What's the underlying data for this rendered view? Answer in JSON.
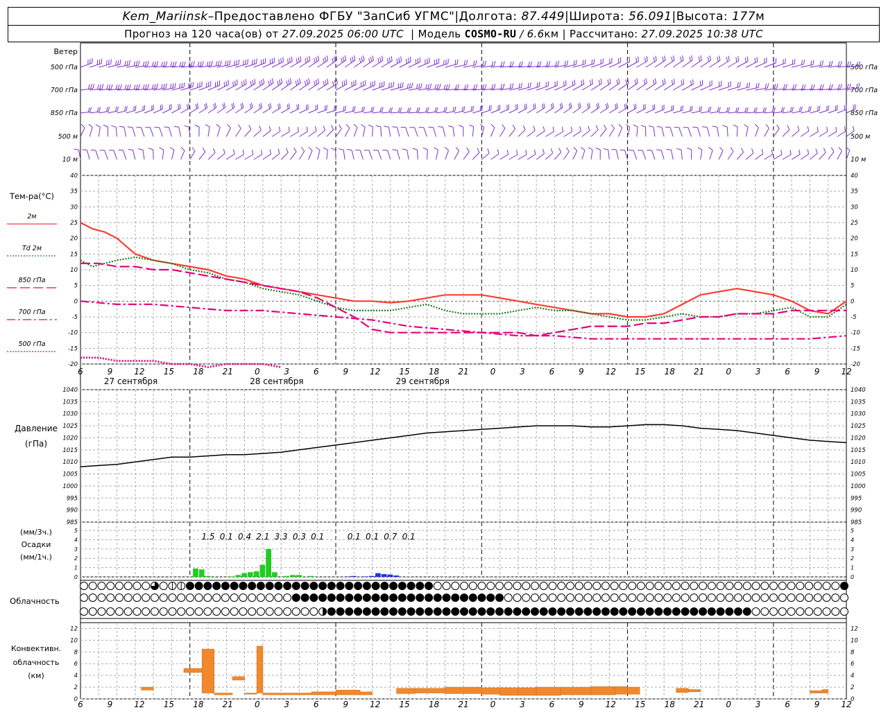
{
  "header": {
    "station": "Kem_Mariinsk",
    "dash": " – ",
    "provider": "Предоставлено ФГБУ \"ЗапСиб УГМС\"",
    "sep": " | ",
    "lon_label": "Долгота:",
    "lon_value": "87.449",
    "lat_label": "Широта:",
    "lat_value": "56.091",
    "alt_label": "Высота:",
    "alt_value": "177",
    "alt_unit": "м",
    "forecast_text": "Прогноз на 120 часа(ов) от",
    "issue_time": "27.09.2025 06:00 UTC",
    "model_label": "| Модель",
    "model_name": "COSMO-RU",
    "model_res": "/ 6.6",
    "model_res_unit": "км",
    "calc_label": "| Рассчитано:",
    "calc_time": "27.09.2025 10:38 UTC"
  },
  "time_axis": {
    "start_hour_utc": 6,
    "hours": 126,
    "hour_labels": [
      "6",
      "9",
      "12",
      "15",
      "18",
      "21",
      "0",
      "3",
      "6",
      "9",
      "12",
      "15",
      "18",
      "21",
      "0",
      "3",
      "6",
      "9",
      "12",
      "15",
      "18",
      "21",
      "0",
      "3",
      "6",
      "9",
      "12"
    ],
    "midnight_hours": [
      18,
      42,
      66,
      90,
      114
    ],
    "day_labels": [
      {
        "text": "27 сентября",
        "hour": 6
      },
      {
        "text": "28 сентября",
        "hour": 30
      },
      {
        "text": "29 сентября",
        "hour": 54
      }
    ]
  },
  "wind_panel": {
    "title": "Ветер",
    "levels": [
      "500 гПа",
      "700 гПа",
      "850 гПа",
      "500 м",
      "10 м"
    ],
    "color": "#7b2fc9"
  },
  "temp_panel": {
    "title": "Тем-ра(°С)",
    "ticks": [
      "40",
      "35",
      "30",
      "25",
      "20",
      "15",
      "10",
      "5",
      "0",
      "-5",
      "-10",
      "-15",
      "-20"
    ],
    "legend": [
      {
        "label": "2м",
        "color": "#ff3b30",
        "style": "solid"
      },
      {
        "label": "Td 2м",
        "color": "#1a7a1a",
        "style": "dotted"
      },
      {
        "label": "850 гПа",
        "color": "#e6007e",
        "style": "dashed"
      },
      {
        "label": "700 гПа",
        "color": "#e6007e",
        "style": "dashdot"
      },
      {
        "label": "500 гПа",
        "color": "#e6007e",
        "style": "dotted"
      }
    ]
  },
  "pressure_panel": {
    "title": "Давление",
    "unit": "(гПа)",
    "ticks": [
      "1040",
      "1035",
      "1030",
      "1025",
      "1020",
      "1015",
      "1010",
      "1005",
      "1000",
      "995",
      "990",
      "985"
    ]
  },
  "precip_panel": {
    "unit_top": "(мм/3ч.)",
    "title": "Осадки",
    "unit_bottom": "(мм/1ч.)",
    "ticks": [
      "5",
      "4",
      "3",
      "2",
      "1",
      "0"
    ],
    "totals": [
      {
        "text": "1.5",
        "hour": 21
      },
      {
        "text": "0.1",
        "hour": 24
      },
      {
        "text": "0.4",
        "hour": 27
      },
      {
        "text": "2.1",
        "hour": 30
      },
      {
        "text": "3.3",
        "hour": 33
      },
      {
        "text": "0.3",
        "hour": 36
      },
      {
        "text": "0.1",
        "hour": 39
      },
      {
        "text": "0.1",
        "hour": 45
      },
      {
        "text": "0.1",
        "hour": 48
      },
      {
        "text": "0.7",
        "hour": 51
      },
      {
        "text": "0.1",
        "hour": 54
      }
    ]
  },
  "cloud_panel": {
    "title": "Облачность"
  },
  "conv_panel": {
    "title_line1": "Конвективн.",
    "title_line2": "облачность",
    "unit": "(км)",
    "ticks": [
      "12",
      "10",
      "8",
      "6",
      "4",
      "2",
      "0"
    ]
  },
  "chart_data": {
    "type": "line",
    "x_unit": "hours from 27.09.2025 06:00 UTC",
    "temperature": {
      "ylim": [
        -20,
        40
      ],
      "series": [
        {
          "name": "2м",
          "x": [
            0,
            2,
            4,
            6,
            9,
            12,
            15,
            18,
            21,
            24,
            27,
            30,
            33,
            36,
            39,
            42,
            45,
            48,
            51,
            54,
            57,
            60,
            63,
            66,
            69,
            72,
            75,
            78,
            81,
            84,
            87,
            90,
            93,
            96,
            99,
            102,
            105,
            108,
            111,
            114,
            117,
            120,
            123,
            126
          ],
          "values": [
            25,
            23,
            22,
            20,
            15,
            13,
            12,
            11,
            10,
            8,
            7,
            5,
            4,
            3,
            2,
            1,
            0,
            0,
            -0.5,
            0,
            1,
            2,
            2,
            2,
            1,
            0,
            -1,
            -2,
            -3,
            -4,
            -4,
            -5,
            -5,
            -4,
            -1,
            2,
            3,
            4,
            3,
            2,
            0,
            -3,
            -4,
            0
          ]
        },
        {
          "name": "Td 2м",
          "x": [
            0,
            2,
            4,
            6,
            9,
            12,
            15,
            18,
            21,
            24,
            27,
            30,
            33,
            36,
            39,
            42,
            45,
            48,
            51,
            54,
            57,
            60,
            63,
            66,
            69,
            72,
            75,
            78,
            81,
            84,
            87,
            90,
            93,
            96,
            99,
            102,
            105,
            108,
            111,
            114,
            117,
            120,
            123,
            126
          ],
          "values": [
            13,
            11,
            12,
            13,
            14,
            13,
            12,
            10,
            9,
            7,
            6,
            4,
            3,
            2,
            0,
            -2,
            -3,
            -3,
            -3,
            -2,
            -1,
            -3,
            -4,
            -4,
            -4,
            -3,
            -2,
            -3,
            -3,
            -4,
            -5,
            -6,
            -6,
            -5,
            -4,
            -5,
            -5,
            -4,
            -4,
            -3,
            -2,
            -5,
            -5,
            -1
          ]
        },
        {
          "name": "850 гПа",
          "x": [
            0,
            3,
            6,
            9,
            12,
            15,
            18,
            21,
            24,
            27,
            30,
            33,
            36,
            39,
            42,
            45,
            48,
            51,
            54,
            57,
            60,
            63,
            66,
            69,
            72,
            75,
            78,
            81,
            84,
            87,
            90,
            93,
            96,
            99,
            102,
            105,
            108,
            111,
            114,
            117,
            120,
            123,
            126
          ],
          "values": [
            12,
            12,
            11,
            11,
            10,
            10,
            9,
            8,
            7,
            6,
            5,
            4,
            3,
            1,
            -2,
            -5,
            -9,
            -10,
            -10,
            -10,
            -10,
            -10,
            -10,
            -10,
            -10,
            -11,
            -10,
            -9,
            -8,
            -8,
            -8,
            -7,
            -7,
            -6,
            -5,
            -5,
            -4,
            -4,
            -4,
            -3,
            -3,
            -3,
            -3
          ]
        },
        {
          "name": "700 гПа",
          "x": [
            0,
            6,
            12,
            18,
            24,
            30,
            36,
            42,
            48,
            54,
            60,
            66,
            72,
            78,
            84,
            90,
            96,
            102,
            108,
            114,
            120,
            126
          ],
          "values": [
            0,
            -1,
            -1,
            -2,
            -3,
            -3,
            -4,
            -5,
            -6,
            -8,
            -9,
            -10,
            -11,
            -11,
            -12,
            -12,
            -12,
            -12,
            -12,
            -12,
            -12,
            -11
          ]
        },
        {
          "name": "500 гПа",
          "x": [
            0,
            3,
            6,
            9,
            12,
            15,
            18,
            21,
            24,
            27,
            30,
            33
          ],
          "values": [
            -18,
            -18,
            -19,
            -19,
            -19,
            -20,
            -20,
            -21,
            -20,
            -20,
            -20,
            -21
          ]
        }
      ]
    },
    "pressure": {
      "ylim": [
        985,
        1040
      ],
      "x": [
        0,
        3,
        6,
        9,
        12,
        15,
        18,
        21,
        24,
        27,
        30,
        33,
        36,
        39,
        42,
        45,
        48,
        51,
        54,
        57,
        60,
        63,
        66,
        69,
        72,
        75,
        78,
        81,
        84,
        87,
        90,
        93,
        96,
        99,
        102,
        105,
        108,
        111,
        114,
        117,
        120,
        123,
        126
      ],
      "values": [
        1008,
        1008.5,
        1009,
        1010,
        1011,
        1012,
        1012,
        1012.5,
        1013,
        1013,
        1013.5,
        1014,
        1015,
        1016,
        1017,
        1018,
        1019,
        1020,
        1021,
        1022,
        1022.5,
        1023,
        1023.5,
        1024,
        1024.5,
        1025,
        1025,
        1025,
        1024.5,
        1024.5,
        1025,
        1025.5,
        1025.5,
        1025,
        1024,
        1023.5,
        1023,
        1022,
        1021,
        1020,
        1019,
        1018.5,
        1018
      ]
    },
    "precipitation_mm_per_hour": {
      "ylim": [
        0,
        5
      ],
      "rain": [
        {
          "hour": 19,
          "value": 0.9
        },
        {
          "hour": 20,
          "value": 0.8
        },
        {
          "hour": 21,
          "value": 0.1
        },
        {
          "hour": 25,
          "value": 0.05
        },
        {
          "hour": 26,
          "value": 0.2
        },
        {
          "hour": 27,
          "value": 0.4
        },
        {
          "hour": 28,
          "value": 0.5
        },
        {
          "hour": 29,
          "value": 0.6
        },
        {
          "hour": 30,
          "value": 1.3
        },
        {
          "hour": 31,
          "value": 3.0
        },
        {
          "hour": 32,
          "value": 0.5
        },
        {
          "hour": 34,
          "value": 0.1
        },
        {
          "hour": 35,
          "value": 0.2
        },
        {
          "hour": 36,
          "value": 0.2
        },
        {
          "hour": 38,
          "value": 0.1
        }
      ],
      "snow": [
        {
          "hour": 44,
          "value": 0.05
        },
        {
          "hour": 45,
          "value": 0.1
        },
        {
          "hour": 47,
          "value": 0.05
        },
        {
          "hour": 48,
          "value": 0.1
        },
        {
          "hour": 49,
          "value": 0.4
        },
        {
          "hour": 50,
          "value": 0.3
        },
        {
          "hour": 51,
          "value": 0.25
        },
        {
          "hour": 52,
          "value": 0.15
        }
      ]
    },
    "cloud_rows": [
      "0000000000002300111244444444444444444444444444444444444444444444440000000000000000000000000000000000000000000000000000000000000000000000000004",
      "000000000000000000000000000000000000000344444444444444444444444444444444444444440000000000000000000000000000000000000000000000000000000000000000",
      "0000000000000000000000000000000000000000000024444444444444444444444444444444444444444444444444444444444444444444444444444444000000000000000000"
    ],
    "convective_cloud_km": [
      {
        "from": 10,
        "to": 12,
        "base": 1.5,
        "top": 2.0
      },
      {
        "from": 17,
        "to": 20,
        "base": 4.5,
        "top": 5.2
      },
      {
        "from": 20,
        "to": 22,
        "base": 1.0,
        "top": 8.5
      },
      {
        "from": 22,
        "to": 25,
        "base": 0.7,
        "top": 1.0
      },
      {
        "from": 25,
        "to": 27,
        "base": 3.2,
        "top": 3.8
      },
      {
        "from": 27,
        "to": 29,
        "base": 0.8,
        "top": 1.0
      },
      {
        "from": 29,
        "to": 30,
        "base": 1.0,
        "top": 9.0
      },
      {
        "from": 30,
        "to": 38,
        "base": 0.7,
        "top": 1.0
      },
      {
        "from": 38,
        "to": 42,
        "base": 0.7,
        "top": 1.2
      },
      {
        "from": 42,
        "to": 46,
        "base": 0.7,
        "top": 1.5
      },
      {
        "from": 46,
        "to": 48,
        "base": 0.7,
        "top": 1.2
      },
      {
        "from": 52,
        "to": 55,
        "base": 0.9,
        "top": 1.8
      },
      {
        "from": 55,
        "to": 60,
        "base": 1.0,
        "top": 1.8
      },
      {
        "from": 60,
        "to": 66,
        "base": 0.9,
        "top": 2.0
      },
      {
        "from": 66,
        "to": 69,
        "base": 0.8,
        "top": 1.9
      },
      {
        "from": 69,
        "to": 72,
        "base": 0.6,
        "top": 1.9
      },
      {
        "from": 72,
        "to": 75,
        "base": 0.6,
        "top": 1.9
      },
      {
        "from": 75,
        "to": 79,
        "base": 0.6,
        "top": 2.0
      },
      {
        "from": 79,
        "to": 84,
        "base": 0.7,
        "top": 2.0
      },
      {
        "from": 84,
        "to": 88,
        "base": 0.7,
        "top": 2.1
      },
      {
        "from": 88,
        "to": 90,
        "base": 0.8,
        "top": 2.1
      },
      {
        "from": 90,
        "to": 92,
        "base": 0.8,
        "top": 2.0
      },
      {
        "from": 98,
        "to": 100,
        "base": 1.1,
        "top": 1.8
      },
      {
        "from": 100,
        "to": 102,
        "base": 1.2,
        "top": 1.6
      },
      {
        "from": 120,
        "to": 122,
        "base": 1.0,
        "top": 1.4
      },
      {
        "from": 122,
        "to": 123,
        "base": 1.0,
        "top": 1.6
      }
    ]
  }
}
